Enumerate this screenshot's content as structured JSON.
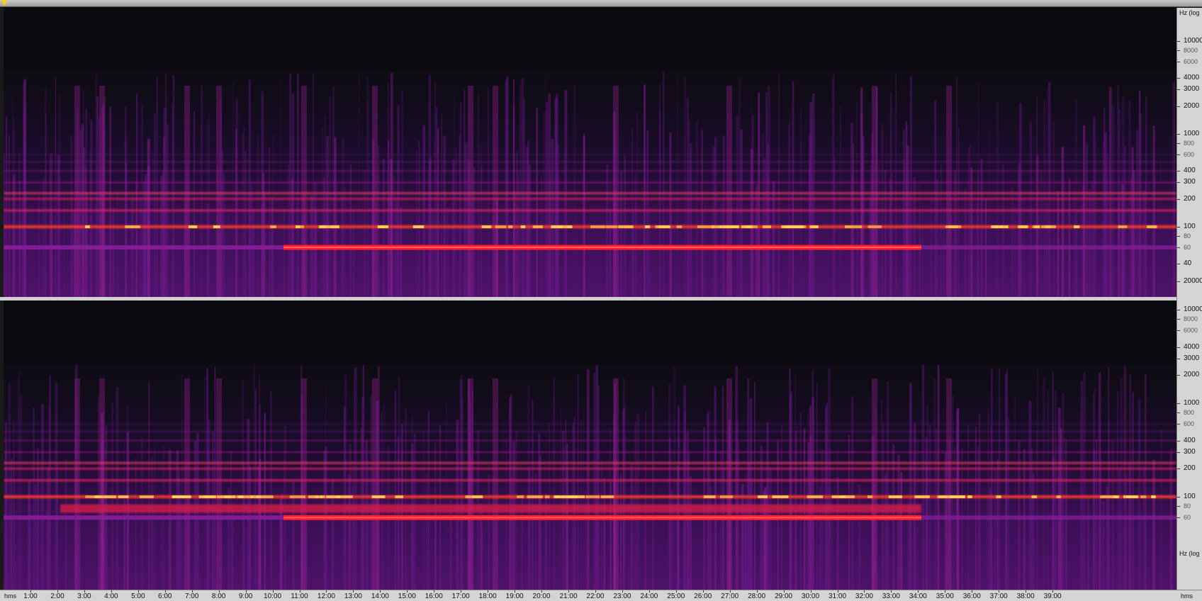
{
  "window": {
    "view": "spectrogram",
    "channels": 2,
    "colormap": [
      "#0c0b12",
      "#2a0a3c",
      "#5a127a",
      "#9a1c8a",
      "#d0205a",
      "#ff2030",
      "#ff7a1a",
      "#ffe46a"
    ],
    "playhead_color": "#f4d10a"
  },
  "freq_axis": {
    "unit_label_top": "Hz (log",
    "unit_label_bottom": "Hz (log",
    "channel1_labels": [
      "10000",
      "8000",
      "6000",
      "4000",
      "3000",
      "2000",
      "1000",
      "800",
      "600",
      "400",
      "300",
      "200",
      "100",
      "80",
      "60",
      "40"
    ],
    "channel2_labels": [
      "20000",
      "10000",
      "8000",
      "6000",
      "4000",
      "3000",
      "2000",
      "1000",
      "800",
      "600",
      "400",
      "300",
      "200",
      "100",
      "80",
      "60"
    ],
    "minor_labels": [
      "8000",
      "6000",
      "800",
      "600",
      "80",
      "60"
    ]
  },
  "time_axis": {
    "unit_left": "hms",
    "unit_right": "hms",
    "labels": [
      "1:00",
      "2:00",
      "3:00",
      "4:00",
      "5:00",
      "6:00",
      "7:00",
      "8:00",
      "9:00",
      "10:00",
      "11:00",
      "12:00",
      "13:00",
      "14:00",
      "15:00",
      "16:00",
      "17:00",
      "18:00",
      "19:00",
      "20:00",
      "21:00",
      "22:00",
      "23:00",
      "24:00",
      "25:00",
      "26:00",
      "27:00",
      "28:00",
      "29:00",
      "30:00",
      "31:00",
      "32:00",
      "33:00",
      "34:00",
      "35:00",
      "36:00",
      "37:00",
      "38:00",
      "39:00"
    ]
  }
}
